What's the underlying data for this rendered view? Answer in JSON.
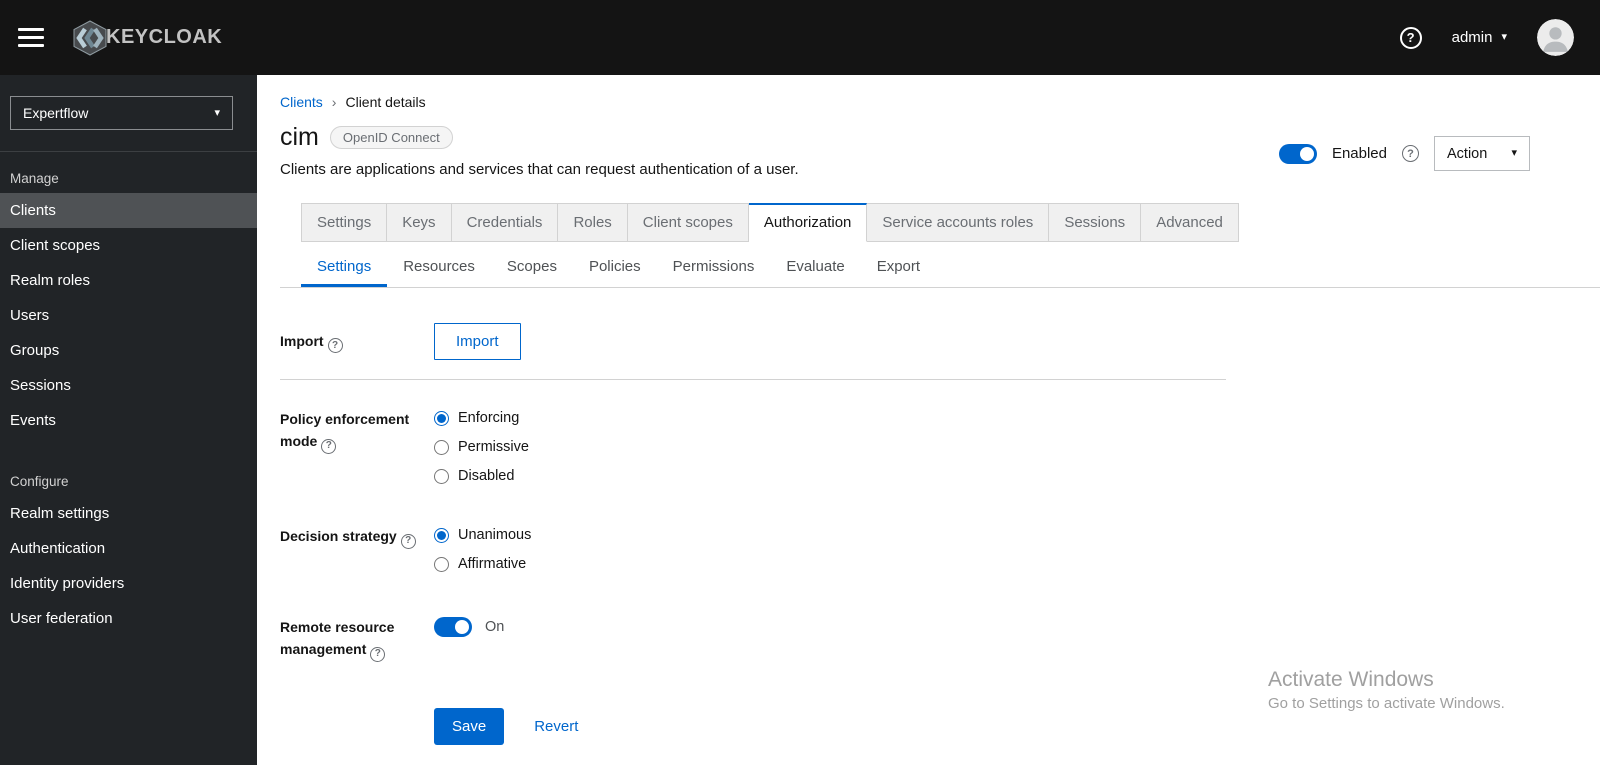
{
  "colors": {
    "accent": "#0066cc",
    "topbar_bg": "#141414",
    "sidebar_bg": "#212427",
    "sidebar_active_bg": "#4f5255",
    "tab_inactive_bg": "#f0f0f0",
    "border": "#d2d2d2"
  },
  "icons": {
    "question_mark": "?",
    "caret_down": "▾",
    "breadcrumb_separator": "›"
  },
  "topbar": {
    "brand": "KEYCLOAK",
    "username": "admin"
  },
  "sidebar": {
    "realm": "Expertflow",
    "manage": {
      "label": "Manage",
      "items": [
        "Clients",
        "Client scopes",
        "Realm roles",
        "Users",
        "Groups",
        "Sessions",
        "Events"
      ]
    },
    "configure": {
      "label": "Configure",
      "items": [
        "Realm settings",
        "Authentication",
        "Identity providers",
        "User federation"
      ]
    },
    "active_item": "Clients"
  },
  "breadcrumb": {
    "items": [
      "Clients",
      "Client details"
    ]
  },
  "header": {
    "title": "cim",
    "badge": "OpenID Connect",
    "description": "Clients are applications and services that can request authentication of a user.",
    "enabled_label": "Enabled",
    "enabled_on": true,
    "action_label": "Action"
  },
  "tabs": {
    "main": [
      "Settings",
      "Keys",
      "Credentials",
      "Roles",
      "Client scopes",
      "Authorization",
      "Service accounts roles",
      "Sessions",
      "Advanced"
    ],
    "main_active": "Authorization",
    "sub": [
      "Settings",
      "Resources",
      "Scopes",
      "Policies",
      "Permissions",
      "Evaluate",
      "Export"
    ],
    "sub_active": "Settings"
  },
  "form": {
    "import": {
      "label": "Import",
      "button_label": "Import"
    },
    "policy_enforcement": {
      "label": "Policy enforcement mode",
      "options": [
        "Enforcing",
        "Permissive",
        "Disabled"
      ],
      "selected": "Enforcing"
    },
    "decision_strategy": {
      "label": "Decision strategy",
      "options": [
        "Unanimous",
        "Affirmative"
      ],
      "selected": "Unanimous"
    },
    "remote_resource": {
      "label": "Remote resource management",
      "toggle_on": true,
      "state_label": "On"
    },
    "save_label": "Save",
    "revert_label": "Revert"
  },
  "watermark": {
    "line1": "Activate Windows",
    "line2": "Go to Settings to activate Windows."
  }
}
